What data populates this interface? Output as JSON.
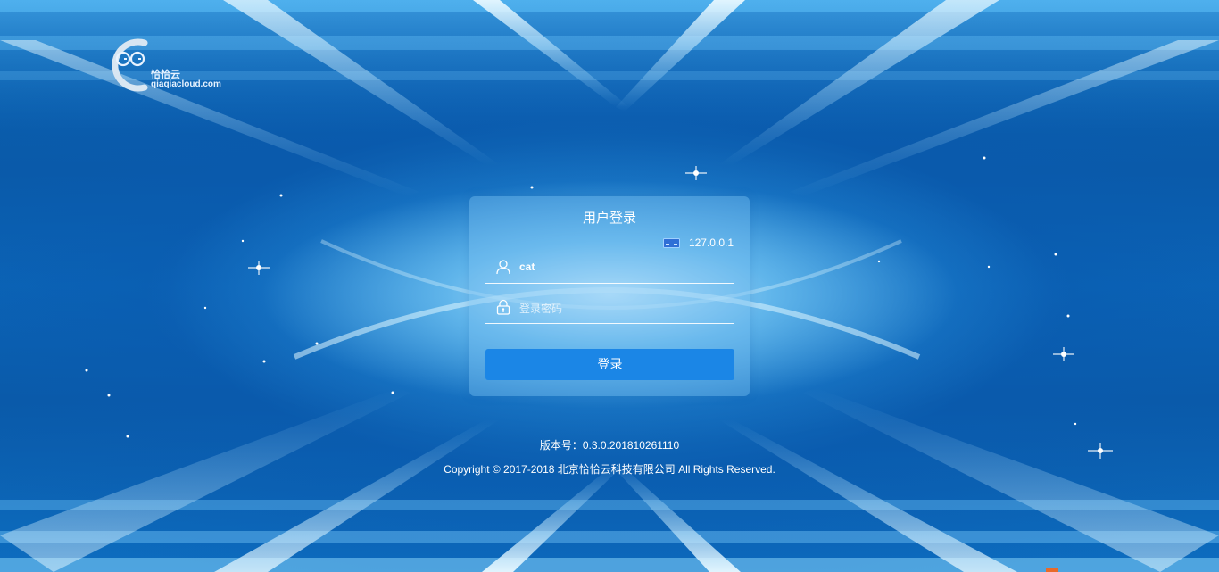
{
  "brand": {
    "name_cn": "恰恰云",
    "domain": "qiaqiacloud.com"
  },
  "login": {
    "title": "用户登录",
    "server_icon": "server-icon",
    "server_address": "127.0.0.1",
    "username_icon": "user-icon",
    "username_value": "cat",
    "password_icon": "lock-icon",
    "password_placeholder": "登录密码",
    "submit_label": "登录"
  },
  "footer": {
    "version": "版本号：0.3.0.201810261110",
    "copyright": "Copyright © 2017-2018 北京恰恰云科技有限公司 All Rights Reserved."
  },
  "colors": {
    "button": "#1b86e6",
    "background": "#0b63b3"
  }
}
